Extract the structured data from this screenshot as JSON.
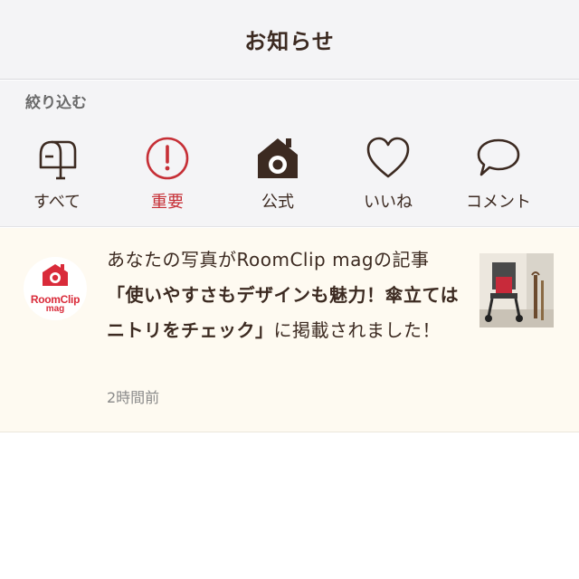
{
  "header": {
    "title": "お知らせ"
  },
  "filter": {
    "label": "絞り込む",
    "items": [
      {
        "label": "すべて",
        "icon": "mailbox-icon"
      },
      {
        "label": "重要",
        "icon": "exclamation-circle-icon",
        "color": "#c62f36"
      },
      {
        "label": "公式",
        "icon": "roomclip-house-icon"
      },
      {
        "label": "いいね",
        "icon": "heart-icon"
      },
      {
        "label": "コメント",
        "icon": "speech-bubble-icon"
      }
    ]
  },
  "notifications": [
    {
      "avatar": {
        "brand": "RoomClip",
        "sub": "mag"
      },
      "text_before": "あなたの写真がRoomClip magの記事",
      "text_bold": "「使いやすさもデザインも魅力！傘立てはニトリをチェック」",
      "text_after": "に掲載されました！",
      "time": "2時間前"
    }
  ],
  "colors": {
    "text": "#3c2a21",
    "accent_red": "#c62f36",
    "notification_bg": "#fefaf1",
    "header_bg": "#f4f4f6"
  }
}
